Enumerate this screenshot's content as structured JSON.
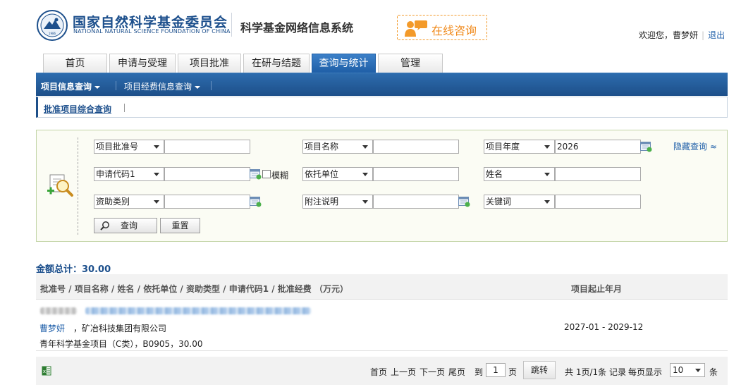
{
  "header": {
    "org_name_cn": "国家自然科学基金委员会",
    "org_name_en": "NATIONAL NATURAL SCIENCE FOUNDATION OF CHINA",
    "system_title": "科学基金网络信息系统",
    "consult_label": "在线咨询",
    "welcome_text": "欢迎您，曹梦妍",
    "logout_label": "退出"
  },
  "tabs": [
    {
      "label": "首页"
    },
    {
      "label": "申请与受理"
    },
    {
      "label": "项目批准"
    },
    {
      "label": "在研与结题"
    },
    {
      "label": "查询与统计",
      "active": true
    },
    {
      "label": "管理"
    }
  ],
  "nav": {
    "items": [
      "项目信息查询",
      "项目经费信息查询"
    ],
    "sub_items": [
      "批准项目综合查询"
    ]
  },
  "query": {
    "fields": [
      {
        "label": "项目批准号",
        "value": ""
      },
      {
        "label": "项目名称",
        "value": ""
      },
      {
        "label": "项目年度",
        "value": "2026"
      },
      {
        "label": "申请代码1",
        "value": ""
      },
      {
        "label": "依托单位",
        "value": ""
      },
      {
        "label": "姓名",
        "value": ""
      },
      {
        "label": "资助类别",
        "value": ""
      },
      {
        "label": "附注说明",
        "value": ""
      },
      {
        "label": "关键词",
        "value": ""
      }
    ],
    "fuzzy_label": "模糊",
    "hide_label": "隐藏查询 ≈",
    "search_label": "查询",
    "reset_label": "重置"
  },
  "results": {
    "total_label": "金额总计：30.00",
    "headers": [
      "批准号 / 项目名称 / 姓名 / 依托单位 / 资助类型 / 申请代码1 / 批准经费 （万元）",
      "项目起止年月"
    ],
    "rows": [
      {
        "person": "曹梦妍",
        "institution": "，矿冶科技集团有限公司",
        "funding_info": "青年科学基金项目（C类），B0905，30.00",
        "period": "2027-01 - 2029-12"
      }
    ]
  },
  "pager": {
    "first": "首页",
    "prev": "上一页",
    "next": "下一页",
    "last": "尾页",
    "goto": "到",
    "page_value": "1",
    "page_unit": "页",
    "jump": "跳转",
    "summary": "共 1页/1条 记录",
    "per_page_label": "每页显示",
    "per_page_value": "10",
    "per_page_unit": "条"
  },
  "colors": {
    "brand_blue": "#1c4f8c",
    "accent_orange": "#f08a1c",
    "link_blue": "#1f5fa9"
  }
}
